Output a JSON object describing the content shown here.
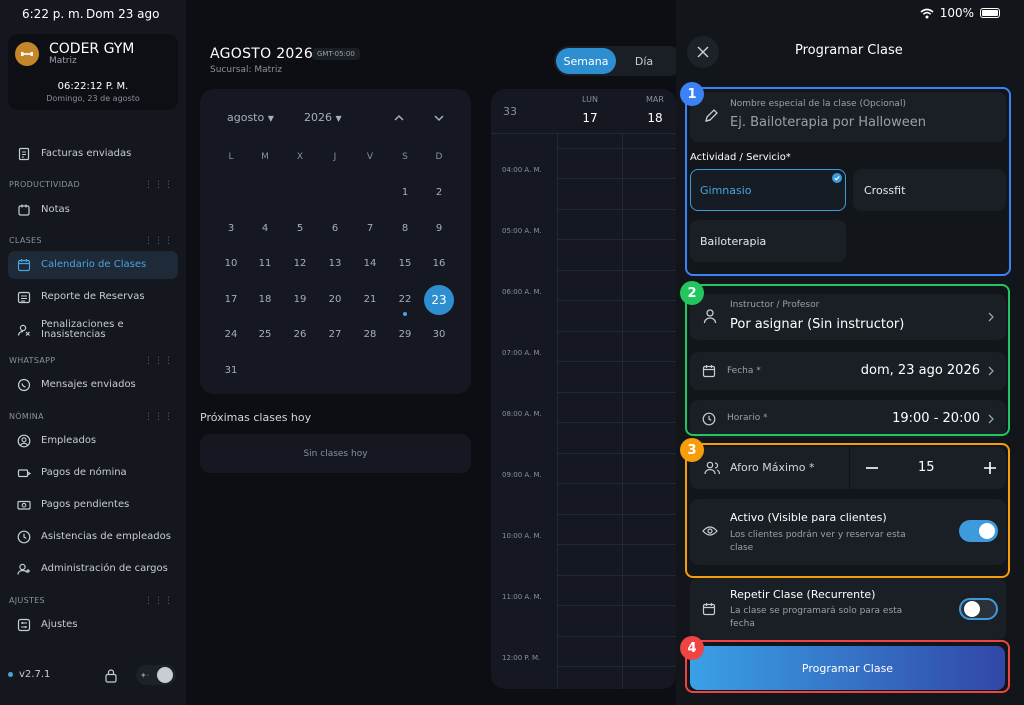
{
  "status_bar": {
    "time": "6:22 p. m.",
    "date": "Dom 23 ago",
    "battery": "100%"
  },
  "brand": {
    "name": "CODER GYM",
    "branch": "Matriz",
    "clock": "06:22:12 P. M.",
    "date": "Domingo, 23 de agosto"
  },
  "sidebar": {
    "top_item": "Facturas enviadas",
    "sections": {
      "productividad": "PRODUCTIVIDAD",
      "clases": "CLASES",
      "whatsapp": "WHATSAPP",
      "nomina": "NÓMINA",
      "ajustes": "AJUSTES"
    },
    "items": {
      "notas": "Notas",
      "calendario": "Calendario de Clases",
      "reporte": "Reporte de Reservas",
      "penalizaciones_1": "Penalizaciones e",
      "penalizaciones_2": "Inasistencias",
      "mensajes": "Mensajes enviados",
      "empleados": "Empleados",
      "pagos_nomina": "Pagos de nómina",
      "pagos_pendientes": "Pagos pendientes",
      "asistencias": "Asistencias de empleados",
      "cargos": "Administración de cargos",
      "ajustes": "Ajustes"
    },
    "version": "v2.7.1"
  },
  "main": {
    "title": "AGOSTO 2026",
    "timezone": "GMT-05:00",
    "subtitle": "Sucursal: Matriz",
    "view_week": "Semana",
    "view_day": "Día"
  },
  "calendar": {
    "month": "agosto",
    "year": "2026",
    "weekdays": [
      "L",
      "M",
      "X",
      "J",
      "V",
      "S",
      "D"
    ],
    "first_col": 5,
    "days_in_month": 31,
    "selected": 23,
    "dotted": 22
  },
  "proximas": {
    "title": "Próximas clases hoy",
    "empty": "Sin clases hoy"
  },
  "week": {
    "number": "33",
    "days": [
      {
        "name": "LUN",
        "num": "17"
      },
      {
        "name": "MAR",
        "num": "18"
      }
    ],
    "times": [
      "04:00 A. M.",
      "05:00 A. M.",
      "06:00 A. M.",
      "07:00 A. M.",
      "08:00 A. M.",
      "09:00 A. M.",
      "10:00 A. M.",
      "11:00 A. M.",
      "12:00 P. M."
    ]
  },
  "panel": {
    "title": "Programar Clase",
    "nombre_label": "Nombre especial de la clase (Opcional)",
    "nombre_placeholder": "Ej. Bailoterapia por Halloween",
    "actividad_label": "Actividad / Servicio*",
    "activities": [
      "Gimnasio",
      "Crossfit",
      "Bailoterapia"
    ],
    "instructor_label": "Instructor / Profesor",
    "instructor_value": "Por asignar (Sin instructor)",
    "fecha_label": "Fecha *",
    "fecha_value": "dom, 23 ago 2026",
    "horario_label": "Horario *",
    "horario_value": "19:00 - 20:00",
    "aforo_label": "Aforo Máximo *",
    "aforo_value": "15",
    "activo_title": "Activo (Visible para clientes)",
    "activo_desc_1": "Los clientes podrán ver y reservar esta",
    "activo_desc_2": "clase",
    "activo_on": true,
    "repetir_title": "Repetir Clase (Recurrente)",
    "repetir_desc_1": "La clase se programará solo para esta",
    "repetir_desc_2": "fecha",
    "repetir_on": false,
    "submit": "Programar Clase"
  },
  "annotations": {
    "labels": [
      "1",
      "2",
      "3",
      "4"
    ],
    "colors": [
      "#3b82f6",
      "#22c55e",
      "#f59e0b",
      "#ef4444"
    ]
  }
}
